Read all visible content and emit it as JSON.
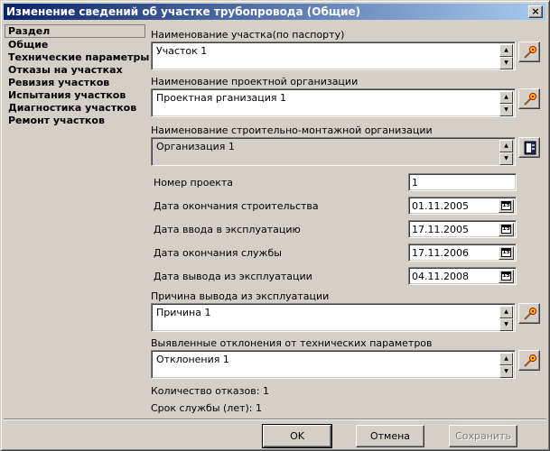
{
  "window": {
    "title": "Изменение сведений об участке трубопровода (Общие)",
    "close_glyph": "×"
  },
  "sidebar": {
    "header": "Раздел",
    "items": [
      {
        "label": "Общие"
      },
      {
        "label": "Технические параметры"
      },
      {
        "label": "Отказы на участках"
      },
      {
        "label": "Ревизия участков"
      },
      {
        "label": "Испытания участков"
      },
      {
        "label": "Диагностика участков"
      },
      {
        "label": "Ремонт участков"
      }
    ]
  },
  "form": {
    "section_name": {
      "label": "Наименование участка(по паспорту)",
      "value": "Участок 1",
      "icon": "magic-wand-icon"
    },
    "design_org": {
      "label": "Наименование проектной организации",
      "value": "Проектная рганизация 1",
      "icon": "magic-wand-icon"
    },
    "construction_org": {
      "label": "Наименование строительно-монтажной организации",
      "value": "Организация 1",
      "icon": "directory-icon"
    },
    "project_number": {
      "label": "Номер проекта",
      "value": "1"
    },
    "construction_end": {
      "label": "Дата окончания строительства",
      "value": "01.11.2005"
    },
    "commissioning_date": {
      "label": "Дата ввода в эксплуатацию",
      "value": "17.11.2005"
    },
    "service_end": {
      "label": "Дата окончания службы",
      "value": "17.11.2006"
    },
    "decommission_date": {
      "label": "Дата вывода из эксплуатации",
      "value": "04.11.2008"
    },
    "decommission_reason": {
      "label": "Причина вывода из эксплуатации",
      "value": "Причина 1",
      "icon": "magic-wand-icon"
    },
    "deviations": {
      "label": "Выявленные отклонения от технических параметров",
      "value": "Отклонения 1",
      "icon": "magic-wand-icon"
    },
    "failure_count": "Количество отказов: 1",
    "service_life": "Срок службы (лет): 1",
    "calendar_glyph": "15"
  },
  "buttons": {
    "ok": "OK",
    "cancel": "Отмена",
    "save": "Сохранить"
  },
  "colors": {
    "title_gradient_start": "#0a246a",
    "title_gradient_end": "#a6caf0",
    "face": "#d4d0c8"
  }
}
